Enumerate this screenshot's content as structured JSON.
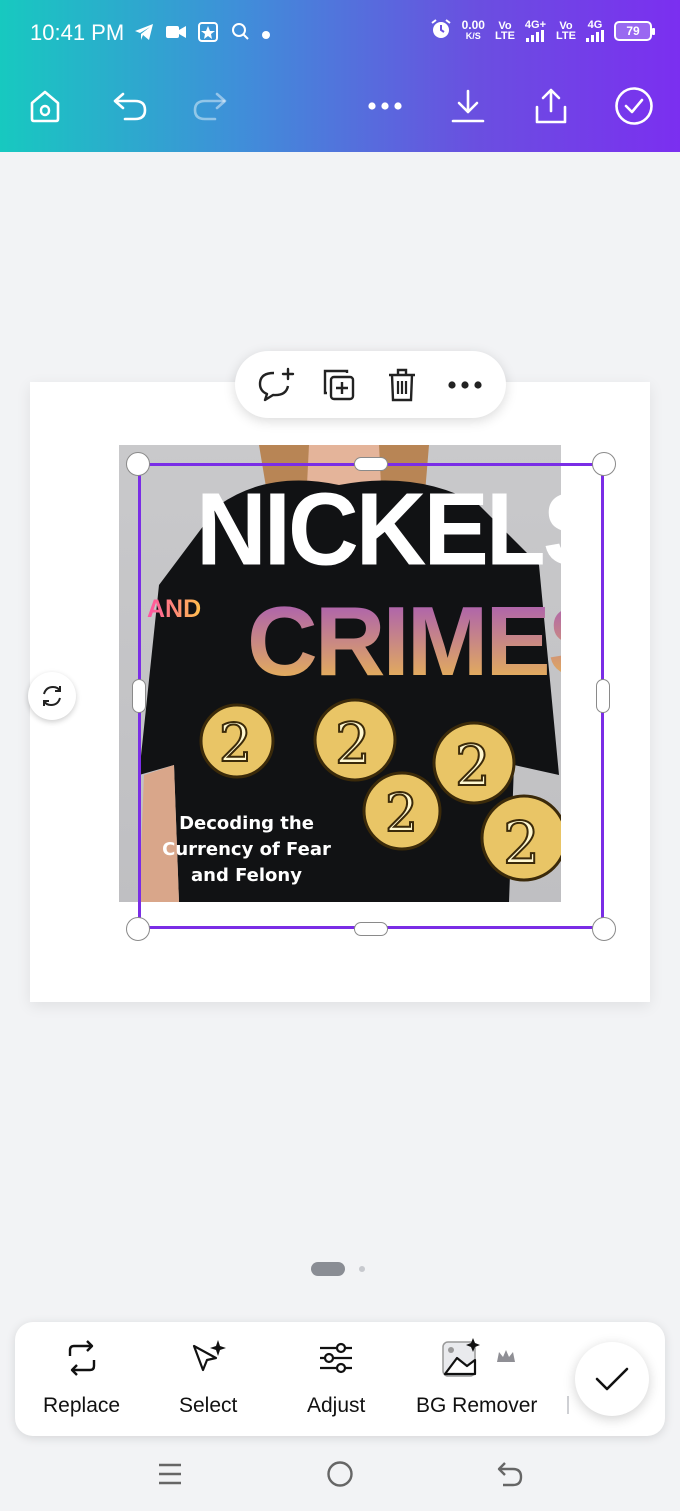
{
  "status_bar": {
    "time": "10:41 PM",
    "net_speed": "0.00",
    "net_unit": "K/S",
    "vo1_top": "Vo",
    "vo1_bottom": "LTE",
    "net1": "4G+",
    "vo2_top": "Vo",
    "vo2_bottom": "LTE",
    "net2": "4G",
    "battery": "79",
    "icons": [
      "telegram-icon",
      "video-icon",
      "app-icon",
      "app-icon",
      "dot-icon",
      "alarm-icon",
      "signal-icon"
    ]
  },
  "toolbar": {
    "icons": [
      "home-icon",
      "undo-icon",
      "redo-icon",
      "more-icon",
      "download-icon",
      "share-icon",
      "check-circle-icon"
    ]
  },
  "context_toolbar": {
    "icons": [
      "comment-add-icon",
      "duplicate-icon",
      "delete-icon",
      "more-icon"
    ]
  },
  "design": {
    "title_line1": "NICKELS",
    "title_and": "AND",
    "title_line2": "CRIMES",
    "subtitle_line1": "Decoding the",
    "subtitle_line2": "Currency of Fear",
    "subtitle_line3": "and Felony"
  },
  "bottom_tools": {
    "replace": "Replace",
    "select": "Select",
    "adjust": "Adjust",
    "bg_remover": "BG Remover"
  },
  "colors": {
    "accent": "#7a2de6",
    "header_start": "#17c9c0",
    "header_end": "#7b2ff0"
  }
}
